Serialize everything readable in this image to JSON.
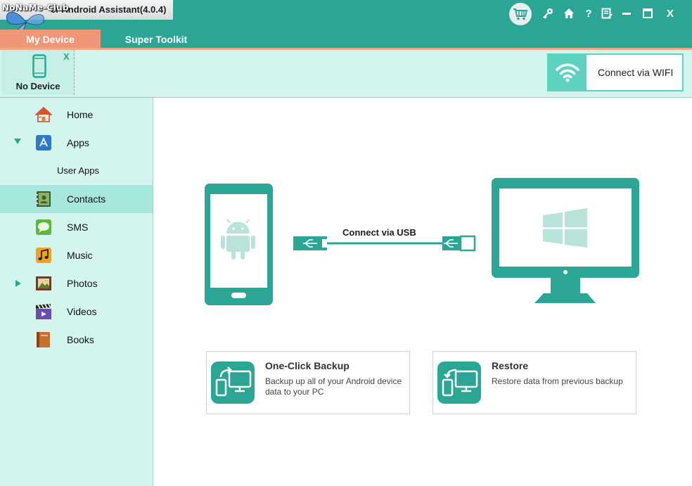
{
  "app": {
    "title": "er Android Assistant(4.0.4)",
    "watermark": "NoNaMe-Club"
  },
  "tabs": [
    {
      "label": "My Device",
      "active": true
    },
    {
      "label": "Super Toolkit",
      "active": false
    }
  ],
  "toolbar": {
    "help_label": "?",
    "close_label": "X"
  },
  "device": {
    "label": "No Device",
    "close_label": "X"
  },
  "wifi": {
    "label": "Connect via WIFI"
  },
  "sidebar": {
    "items": [
      {
        "label": "Home",
        "icon": "home-icon"
      },
      {
        "label": "Apps",
        "icon": "apps-icon",
        "expanded": true
      },
      {
        "label": "User Apps",
        "sub": true
      },
      {
        "label": "Contacts",
        "icon": "contacts-icon",
        "selected": true
      },
      {
        "label": "SMS",
        "icon": "sms-icon"
      },
      {
        "label": "Music",
        "icon": "music-icon"
      },
      {
        "label": "Photos",
        "icon": "photos-icon",
        "expanded": false
      },
      {
        "label": "Videos",
        "icon": "videos-icon"
      },
      {
        "label": "Books",
        "icon": "books-icon"
      }
    ]
  },
  "main": {
    "usb_label": "Connect via USB",
    "backup": {
      "title": "One-Click Backup",
      "desc": "Backup up all of your Android device data to your PC"
    },
    "restore": {
      "title": "Restore",
      "desc": "Restore data from previous backup"
    }
  },
  "colors": {
    "accent": "#2ba695",
    "tab_active": "#f0977a",
    "sidebar_bg": "#d4f5ee",
    "sidebar_selected": "#a7e8dc",
    "wifi_accent": "#5fd2bf"
  }
}
